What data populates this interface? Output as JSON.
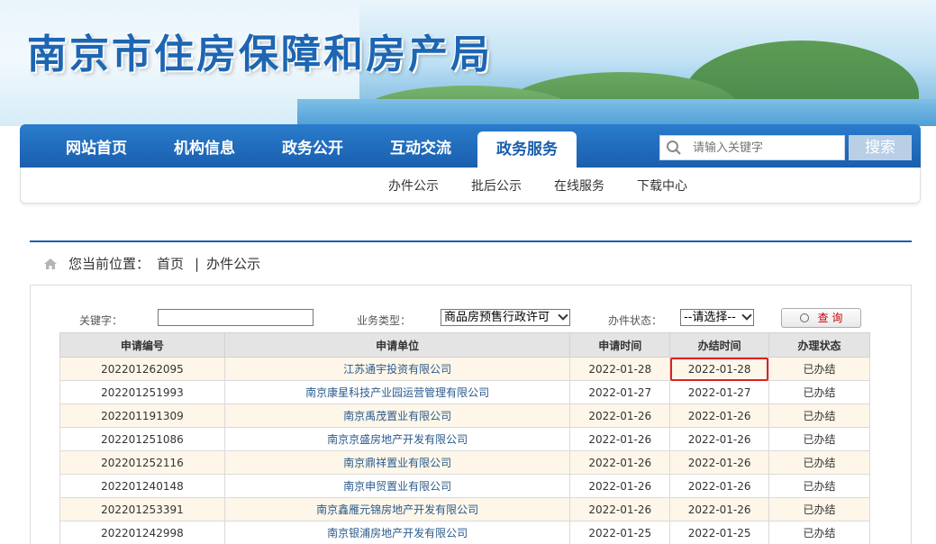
{
  "banner": {
    "title": "南京市住房保障和房产局"
  },
  "nav": {
    "items": [
      {
        "label": "网站首页"
      },
      {
        "label": "机构信息"
      },
      {
        "label": "政务公开"
      },
      {
        "label": "互动交流"
      },
      {
        "label": "政务服务",
        "active": true
      }
    ],
    "search_placeholder": "请输入关键字",
    "search_button": "搜索"
  },
  "subnav": {
    "items": [
      "办件公示",
      "批后公示",
      "在线服务",
      "下载中心"
    ]
  },
  "breadcrumb": {
    "prefix": "您当前位置：",
    "home": "首页",
    "sep": "|",
    "current": "办件公示"
  },
  "filters": {
    "keyword_label": "关键字：",
    "keyword_value": "",
    "type_label": "业务类型：",
    "type_value": "商品房预售行政许可",
    "status_label": "办件状态：",
    "status_value": "--请选择--",
    "query_button": "查 询"
  },
  "table": {
    "headers": [
      "申请编号",
      "申请单位",
      "申请时间",
      "办结时间",
      "办理状态"
    ],
    "rows": [
      [
        "202201262095",
        "江苏通宇投资有限公司",
        "2022-01-28",
        "2022-01-28",
        "已办结"
      ],
      [
        "202201251993",
        "南京康星科技产业园运营管理有限公司",
        "2022-01-27",
        "2022-01-27",
        "已办结"
      ],
      [
        "202201191309",
        "南京禹茂置业有限公司",
        "2022-01-26",
        "2022-01-26",
        "已办结"
      ],
      [
        "202201251086",
        "南京京盛房地产开发有限公司",
        "2022-01-26",
        "2022-01-26",
        "已办结"
      ],
      [
        "202201252116",
        "南京鼎祥置业有限公司",
        "2022-01-26",
        "2022-01-26",
        "已办结"
      ],
      [
        "202201240148",
        "南京申贸置业有限公司",
        "2022-01-26",
        "2022-01-26",
        "已办结"
      ],
      [
        "202201253391",
        "南京鑫雁元锦房地产开发有限公司",
        "2022-01-26",
        "2022-01-26",
        "已办结"
      ],
      [
        "202201242998",
        "南京银浦房地产开发有限公司",
        "2022-01-25",
        "2022-01-25",
        "已办结"
      ]
    ]
  },
  "colors": {
    "brand_blue": "#1a5fae",
    "highlight": "#e02020",
    "odd_row": "#fdf6e9"
  },
  "icons": {
    "search": "search-icon",
    "home": "home-icon",
    "query": "query-icon"
  }
}
